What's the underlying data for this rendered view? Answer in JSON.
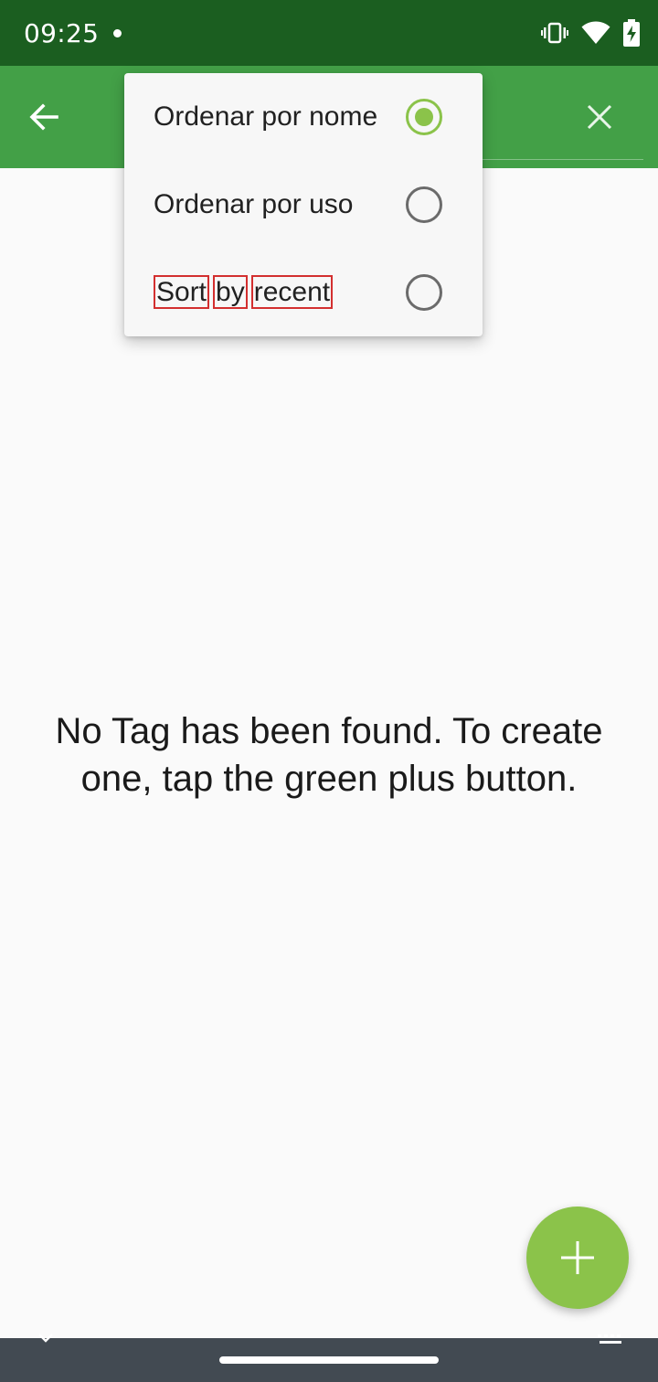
{
  "status_bar": {
    "time": "09:25",
    "icons": [
      "vibrate-icon",
      "wifi-icon",
      "battery-charging-icon"
    ]
  },
  "app_bar": {
    "color": "#43a047",
    "back_icon": "arrow-left-icon",
    "close_icon": "close-icon"
  },
  "sort_menu": {
    "items": [
      {
        "label": "Ordenar por nome",
        "selected": true
      },
      {
        "label": "Ordenar por uso",
        "selected": false
      },
      {
        "label": "Sort by recent",
        "words": [
          "Sort",
          "by",
          "recent"
        ],
        "selected": false
      }
    ],
    "accent_color": "#8bc34a"
  },
  "empty_state": {
    "message": "No Tag has been found. To create one, tap the green plus button."
  },
  "fab": {
    "icon": "plus-icon",
    "color": "#8bc34a"
  },
  "nav_bar": {
    "left_icon": "chevron-down-icon",
    "right_icon": "keyboard-icon"
  }
}
